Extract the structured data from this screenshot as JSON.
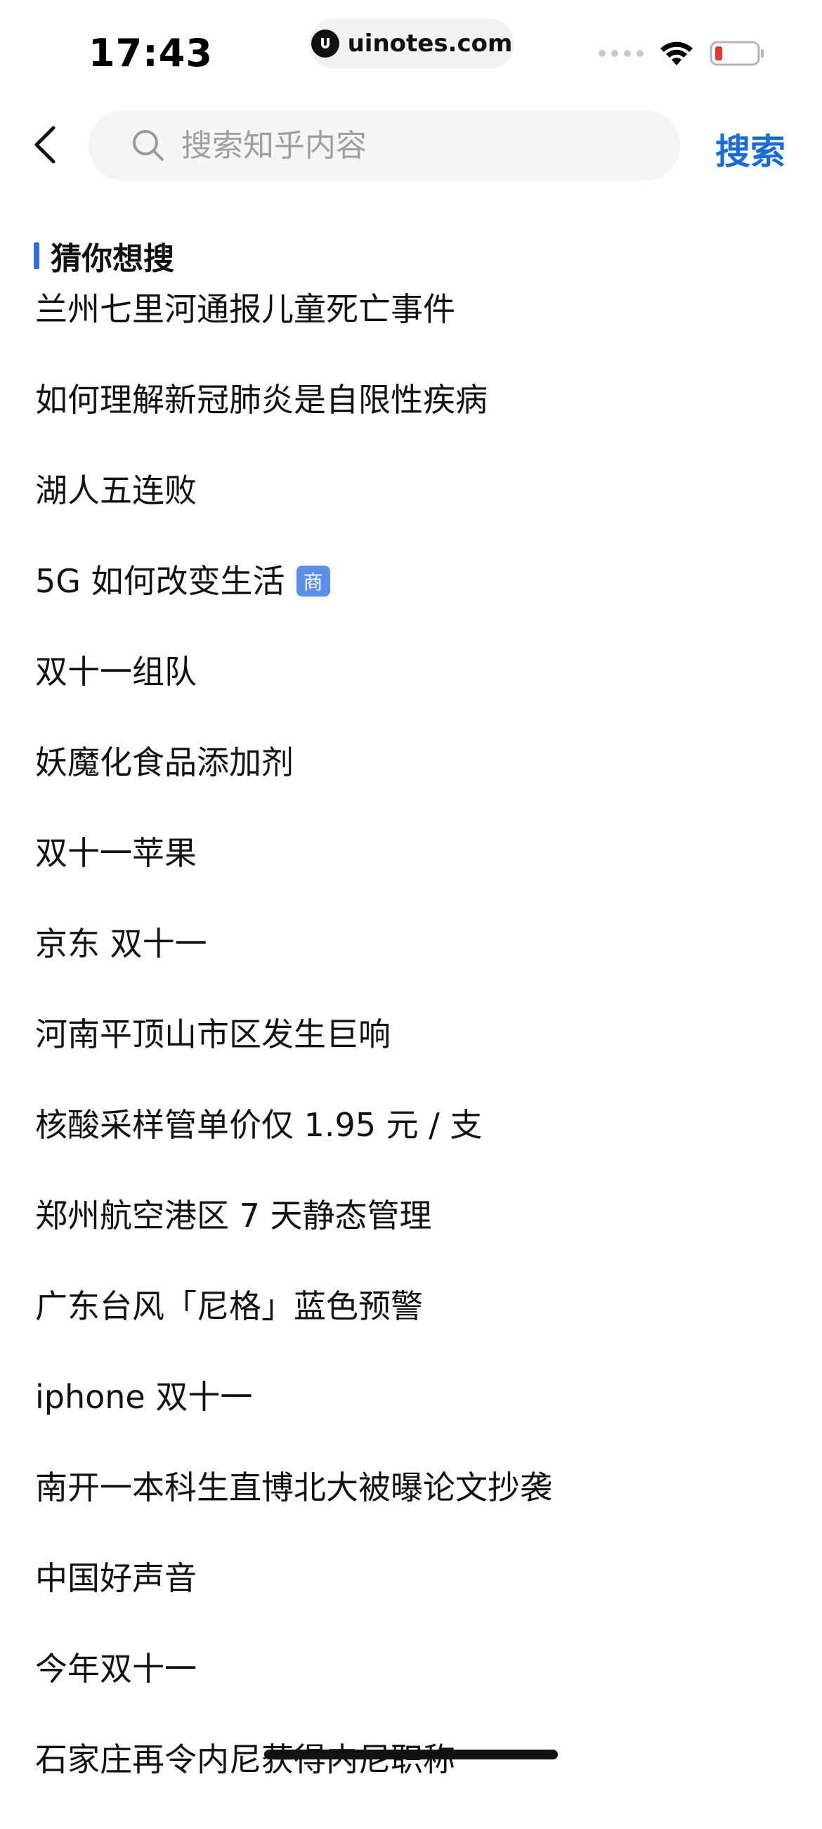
{
  "status_bar": {
    "time": "17:43",
    "url": "uinotes.com",
    "battery_color": "#e53935"
  },
  "search": {
    "placeholder": "搜索知乎内容",
    "submit_label": "搜索"
  },
  "section": {
    "title": "猜你想搜"
  },
  "suggestions": [
    {
      "text": "兰州七里河通报儿童死亡事件"
    },
    {
      "text": "如何理解新冠肺炎是自限性疾病"
    },
    {
      "text": "湖人五连败"
    },
    {
      "text": "5G 如何改变生活",
      "badge": "商"
    },
    {
      "text": "双十一组队"
    },
    {
      "text": "妖魔化食品添加剂"
    },
    {
      "text": "双十一苹果"
    },
    {
      "text": "京东 双十一"
    },
    {
      "text": "河南平顶山市区发生巨响"
    },
    {
      "text": "核酸采样管单价仅 1.95 元 / 支"
    },
    {
      "text": "郑州航空港区 7 天静态管理"
    },
    {
      "text": "广东台风「尼格」蓝色预警"
    },
    {
      "text": "iphone 双十一"
    },
    {
      "text": "南开一本科生直博北大被曝论文抄袭"
    },
    {
      "text": "中国好声音"
    },
    {
      "text": "今年双十一"
    },
    {
      "text": "石家庄再令内尼获得内尼职称"
    }
  ],
  "colors": {
    "accent": "#1a6bd6",
    "section_bar": "#2f6fe4",
    "badge": "#5b8fe9"
  }
}
